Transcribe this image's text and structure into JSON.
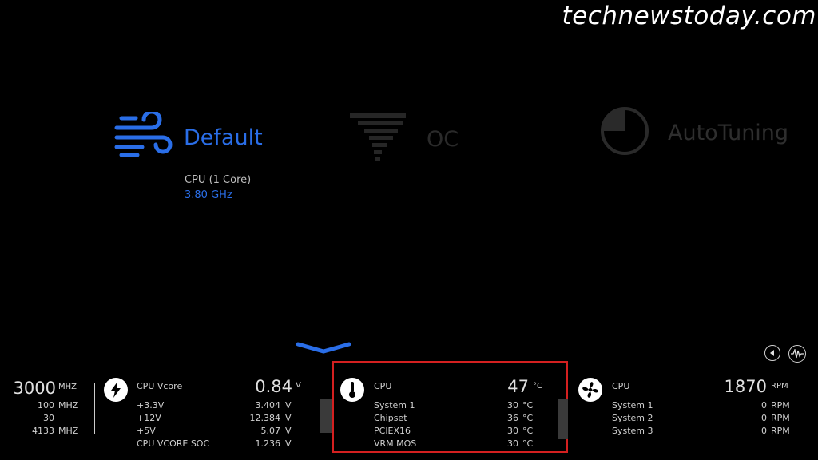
{
  "watermark": "technewstoday.com",
  "modes": {
    "default": {
      "label": "Default",
      "icon": "wind-icon",
      "sub_label": "CPU (1 Core)",
      "sub_value": "3.80 GHz"
    },
    "oc": {
      "label": "OC",
      "icon": "oc-bars-icon"
    },
    "auto": {
      "label": "AutoTuning",
      "icon": "autotuning-dial-icon"
    }
  },
  "controls": {
    "collapse": "chevron-down-icon",
    "back": "back-icon",
    "monitor": "waveform-icon"
  },
  "freq": {
    "main_value": "3000",
    "main_unit": "MHZ",
    "rows": [
      {
        "value": "100",
        "unit": "MHZ"
      },
      {
        "value": "30",
        "unit": ""
      },
      {
        "value": "4133",
        "unit": "MHZ"
      }
    ]
  },
  "voltage": {
    "icon": "lightning-icon",
    "main_label": "CPU Vcore",
    "main_value": "0.84",
    "main_unit": "V",
    "rows": [
      {
        "label": "+3.3V",
        "value": "3.404",
        "unit": "V"
      },
      {
        "label": "+12V",
        "value": "12.384",
        "unit": "V"
      },
      {
        "label": "+5V",
        "value": "5.07",
        "unit": "V"
      },
      {
        "label": "CPU VCORE SOC",
        "value": "1.236",
        "unit": "V"
      }
    ]
  },
  "temperature": {
    "icon": "thermometer-icon",
    "main_label": "CPU",
    "main_value": "47",
    "main_unit": "°C",
    "rows": [
      {
        "label": "System 1",
        "value": "30",
        "unit": "°C"
      },
      {
        "label": "Chipset",
        "value": "36",
        "unit": "°C"
      },
      {
        "label": "PCIEX16",
        "value": "30",
        "unit": "°C"
      },
      {
        "label": "VRM MOS",
        "value": "30",
        "unit": "°C"
      }
    ]
  },
  "fans": {
    "icon": "fan-icon",
    "main_label": "CPU",
    "main_value": "1870",
    "main_unit": "RPM",
    "rows": [
      {
        "label": "System 1",
        "value": "0",
        "unit": "RPM"
      },
      {
        "label": "System 2",
        "value": "0",
        "unit": "RPM"
      },
      {
        "label": "System 3",
        "value": "0",
        "unit": "RPM"
      }
    ]
  },
  "colors": {
    "accent": "#2a6ee8",
    "highlight_border": "#d42020",
    "background": "#000000"
  }
}
